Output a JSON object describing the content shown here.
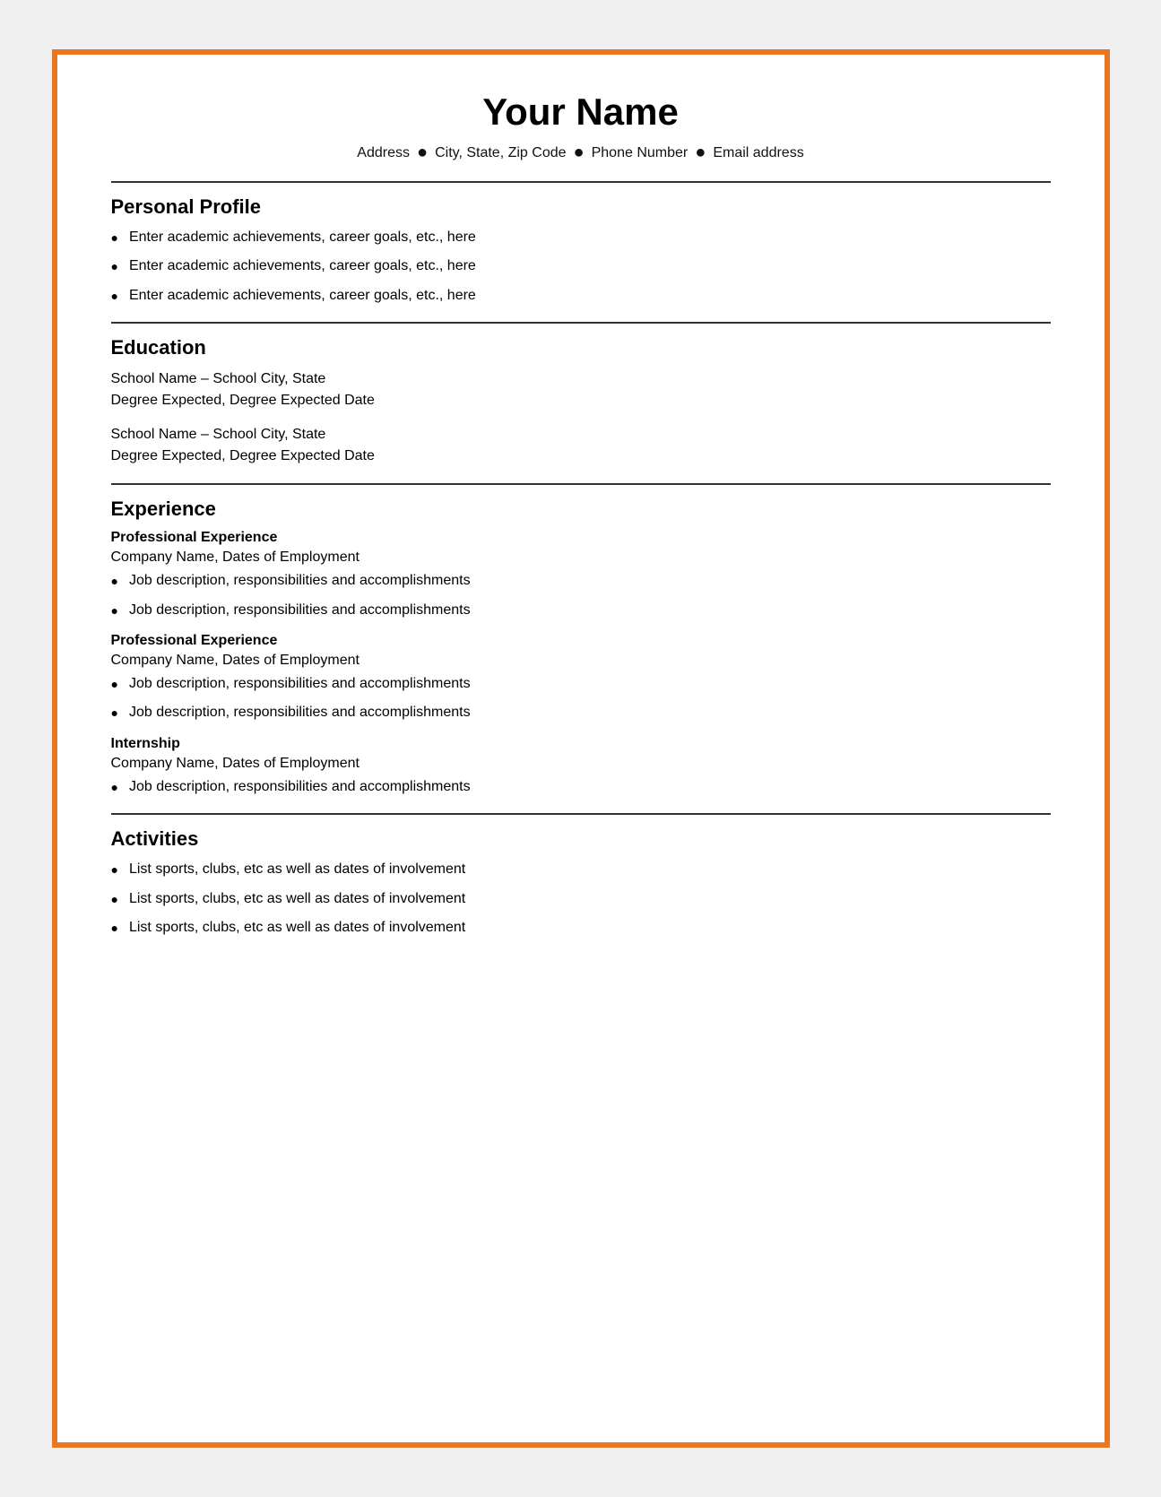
{
  "header": {
    "name": "Your Name",
    "contact": {
      "address": "Address",
      "city": "City, State, Zip Code",
      "phone": "Phone Number",
      "email": "Email address"
    }
  },
  "sections": {
    "personal_profile": {
      "title": "Personal Profile",
      "items": [
        "Enter academic achievements, career goals, etc., here",
        "Enter academic achievements, career goals, etc., here",
        "Enter academic achievements, career goals, etc., here"
      ]
    },
    "education": {
      "title": "Education",
      "entries": [
        {
          "line1": "School Name – School City, State",
          "line2": "Degree Expected, Degree Expected Date"
        },
        {
          "line1": "School Name – School City, State",
          "line2": "Degree Expected, Degree Expected Date"
        }
      ]
    },
    "experience": {
      "title": "Experience",
      "blocks": [
        {
          "subtitle": "Professional Experience",
          "company": "Company Name, Dates of Employment",
          "items": [
            "Job description, responsibilities and accomplishments",
            "Job description, responsibilities and accomplishments"
          ]
        },
        {
          "subtitle": "Professional Experience",
          "company": "Company Name, Dates of Employment",
          "items": [
            "Job description, responsibilities and accomplishments",
            "Job description, responsibilities and accomplishments"
          ]
        },
        {
          "subtitle": "Internship",
          "company": "Company Name, Dates of Employment",
          "items": [
            "Job description, responsibilities and accomplishments"
          ]
        }
      ]
    },
    "activities": {
      "title": "Activities",
      "items": [
        "List sports, clubs, etc as well as dates of involvement",
        "List sports, clubs, etc as well as dates of involvement",
        "List sports, clubs, etc as well as dates of involvement"
      ]
    }
  }
}
